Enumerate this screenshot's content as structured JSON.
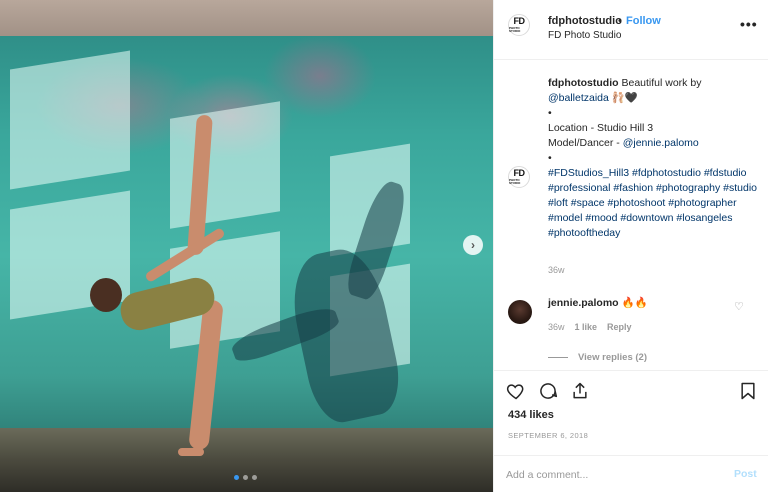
{
  "header": {
    "logo_text": "FD",
    "logo_subtext": "PHOTO STUDIO",
    "username": "fdphotostudio",
    "separator": "•",
    "follow_label": "Follow",
    "subtitle": "FD Photo Studio",
    "more_label": "•••"
  },
  "caption": {
    "username": "fdphotostudio",
    "text_1": "Beautiful work by",
    "mention_1": "@balletzaida",
    "emoji": "🩰🖤",
    "bullet_1": "•",
    "location": "Location - Studio Hill 3",
    "model_label": "Model/Dancer - ",
    "mention_2": "@jennie.palomo",
    "bullet_2": "•",
    "hashtags": "#FDStudios_Hill3 #fdphotostudio #fdstudio #professional #fashion #photography #studio #loft #space #photoshoot #photographer #model #mood #downtown #losangeles #photooftheday",
    "time": "36w"
  },
  "comment": {
    "username": "jennie.palomo",
    "text": "🔥🔥",
    "time": "36w",
    "likes": "1 like",
    "reply_label": "Reply",
    "view_replies": "View replies (2)"
  },
  "actions": {
    "likes": "434 likes",
    "date": "SEPTEMBER 6, 2018"
  },
  "add_comment": {
    "placeholder": "Add a comment...",
    "post_label": "Post"
  },
  "carousel": {
    "next_label": "›",
    "total": 3,
    "active": 1
  },
  "colors": {
    "accent": "#3897f0",
    "link": "#003569",
    "muted": "#999999"
  }
}
